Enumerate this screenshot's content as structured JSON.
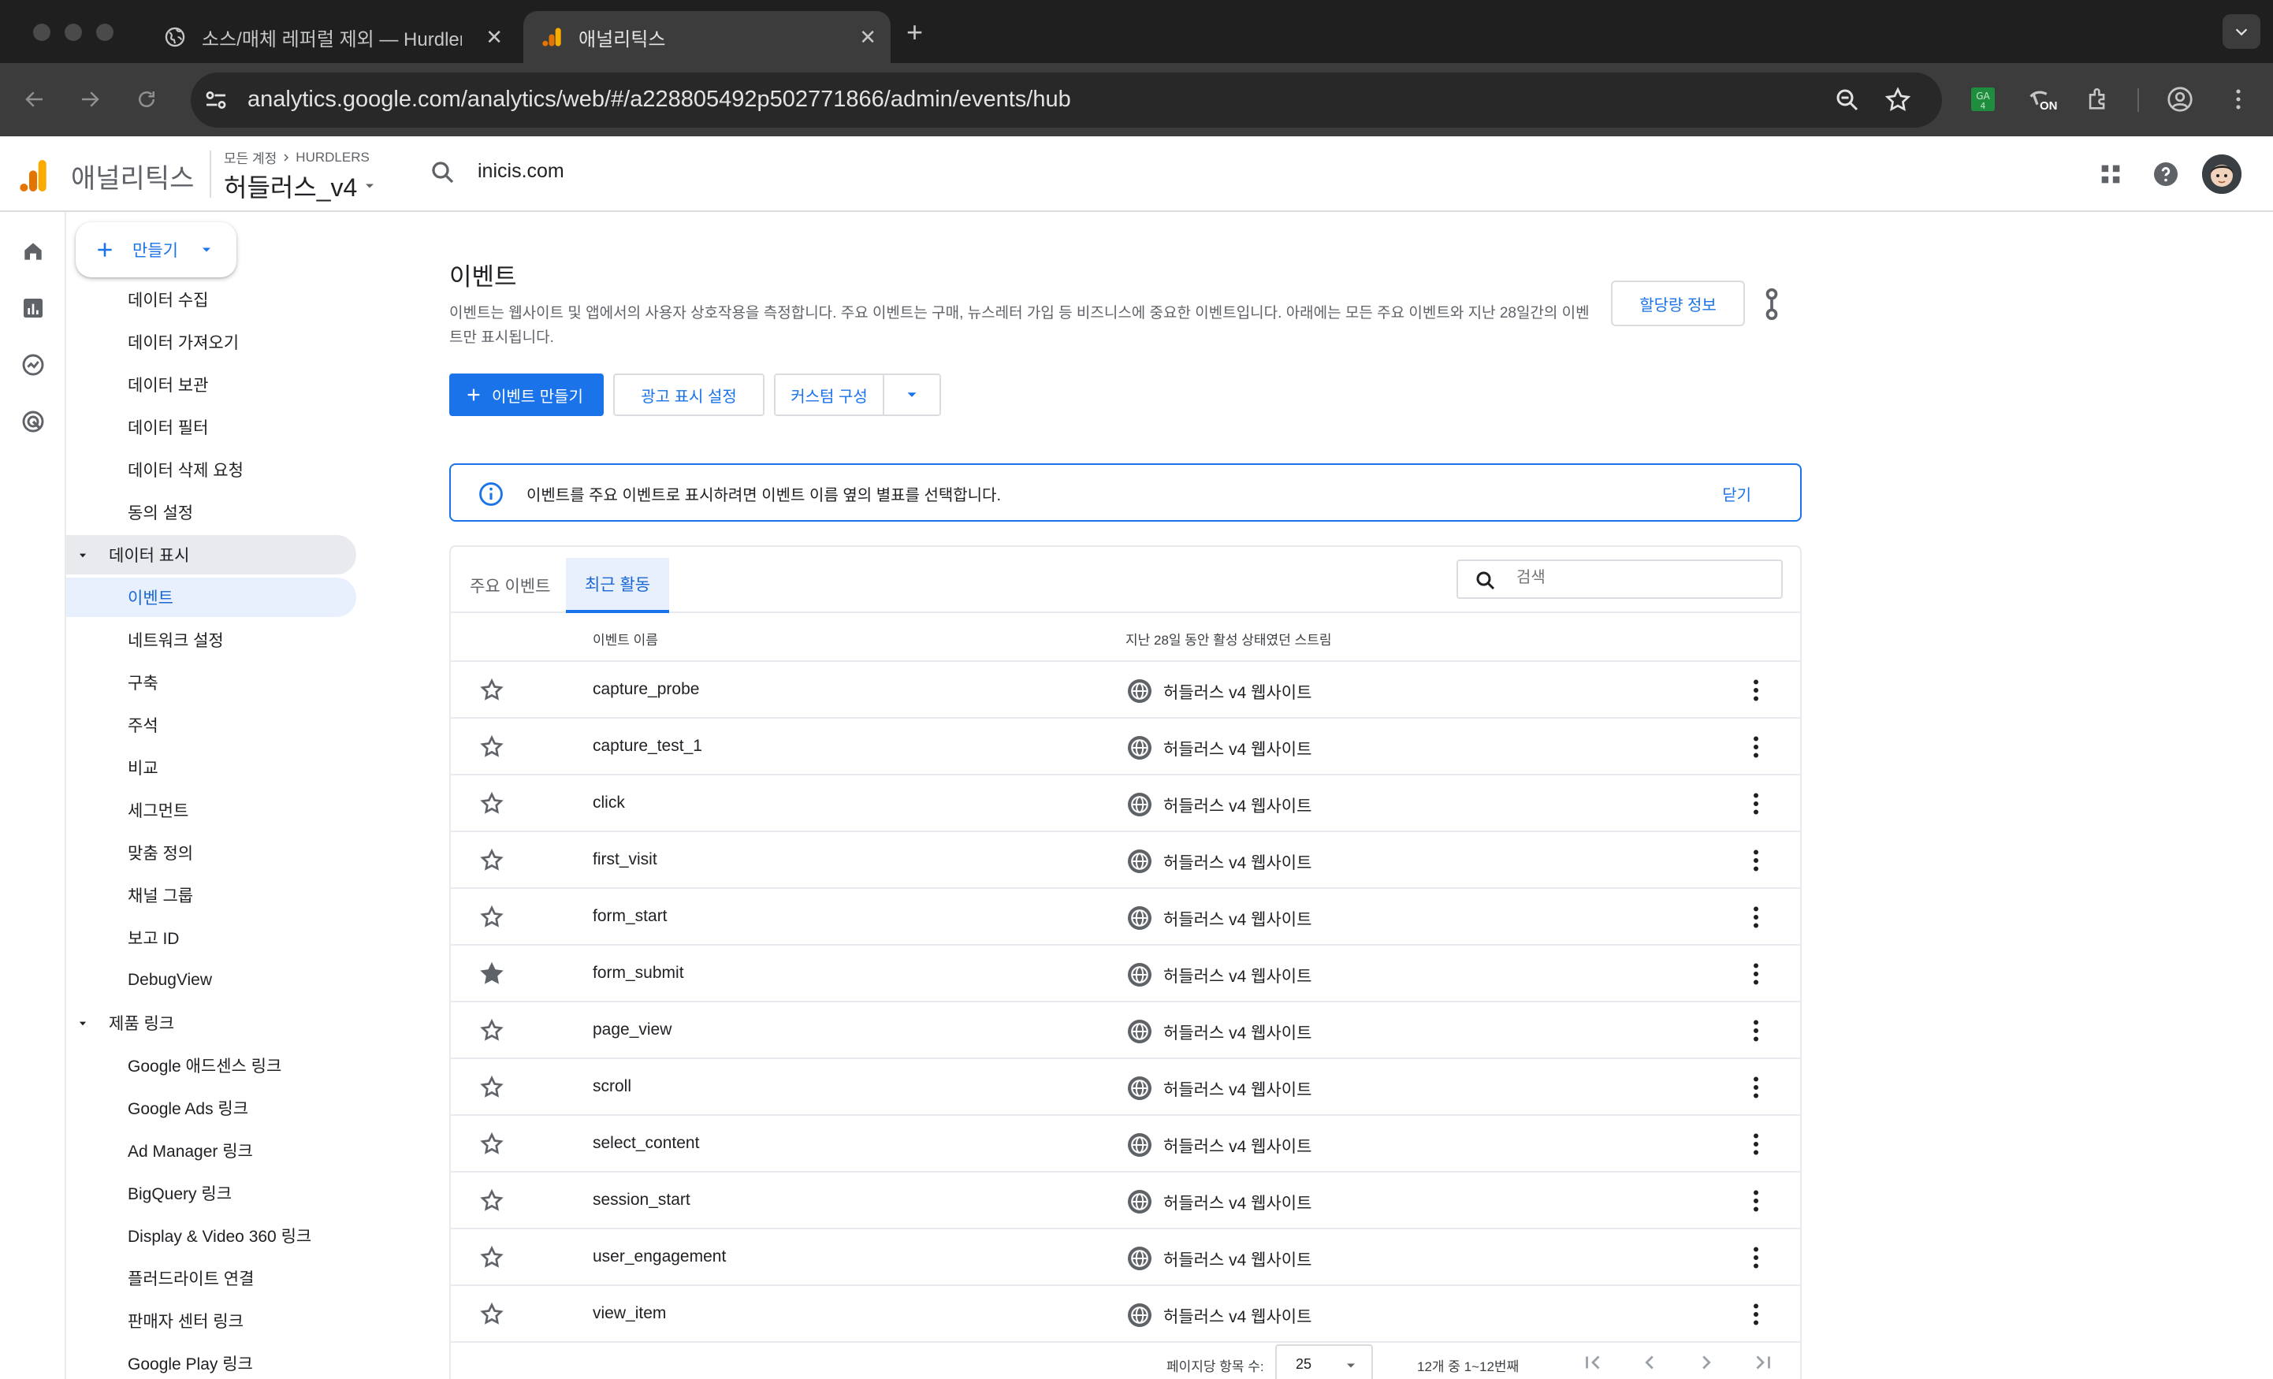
{
  "browser": {
    "tabs": [
      {
        "title": "소스/매체 레퍼럴 제외 — Hurdlers",
        "active": false
      },
      {
        "title": "애널리틱스",
        "active": true
      }
    ],
    "url": "analytics.google.com/analytics/web/#/a228805492p502771866/admin/events/hub",
    "extension_badge": "ON"
  },
  "header": {
    "product": "애널리틱스",
    "breadcrumb_all": "모든 계정",
    "breadcrumb_account": "HURDLERS",
    "property": "허들러스_v4",
    "search_query": "inicis.com"
  },
  "sidebar": {
    "create_label": "만들기",
    "items": [
      {
        "label": "데이터 수집",
        "type": "item"
      },
      {
        "label": "데이터 가져오기",
        "type": "item"
      },
      {
        "label": "데이터 보관",
        "type": "item"
      },
      {
        "label": "데이터 필터",
        "type": "item"
      },
      {
        "label": "데이터 삭제 요청",
        "type": "item"
      },
      {
        "label": "동의 설정",
        "type": "item"
      },
      {
        "label": "데이터 표시",
        "type": "group"
      },
      {
        "label": "이벤트",
        "type": "active"
      },
      {
        "label": "네트워크 설정",
        "type": "item"
      },
      {
        "label": "구축",
        "type": "item"
      },
      {
        "label": "주석",
        "type": "item"
      },
      {
        "label": "비교",
        "type": "item"
      },
      {
        "label": "세그먼트",
        "type": "item"
      },
      {
        "label": "맞춤 정의",
        "type": "item"
      },
      {
        "label": "채널 그룹",
        "type": "item"
      },
      {
        "label": "보고 ID",
        "type": "item"
      },
      {
        "label": "DebugView",
        "type": "item"
      },
      {
        "label": "제품 링크",
        "type": "group2"
      },
      {
        "label": "Google 애드센스 링크",
        "type": "item"
      },
      {
        "label": "Google Ads 링크",
        "type": "item"
      },
      {
        "label": "Ad Manager 링크",
        "type": "item"
      },
      {
        "label": "BigQuery 링크",
        "type": "item"
      },
      {
        "label": "Display & Video 360 링크",
        "type": "item"
      },
      {
        "label": "플러드라이트 연결",
        "type": "item"
      },
      {
        "label": "판매자 센터 링크",
        "type": "item"
      },
      {
        "label": "Google Play 링크",
        "type": "item"
      }
    ]
  },
  "main": {
    "title": "이벤트",
    "description": "이벤트는 웹사이트 및 앱에서의 사용자 상호작용을 측정합니다. 주요 이벤트는 구매, 뉴스레터 가입 등 비즈니스에 중요한 이벤트입니다. 아래에는 모든 주요 이벤트와 지난 28일간의 이벤트만 표시됩니다.",
    "quota_button": "할당량 정보",
    "create_event_button": "이벤트 만들기",
    "ad_settings_button": "광고 표시 설정",
    "custom_config_button": "커스텀 구성",
    "banner_text": "이벤트를 주요 이벤트로 표시하려면 이벤트 이름 옆의 별표를 선택합니다.",
    "banner_close": "닫기",
    "tabs": [
      "주요 이벤트",
      "최근 활동"
    ],
    "search_placeholder": "검색",
    "col_event_name": "이벤트 이름",
    "col_stream": "지난 28일 동안 활성 상태였던 스트림",
    "rows": [
      {
        "name": "capture_probe",
        "stream": "허들러스 v4 웹사이트",
        "key": false
      },
      {
        "name": "capture_test_1",
        "stream": "허들러스 v4 웹사이트",
        "key": false
      },
      {
        "name": "click",
        "stream": "허들러스 v4 웹사이트",
        "key": false
      },
      {
        "name": "first_visit",
        "stream": "허들러스 v4 웹사이트",
        "key": false
      },
      {
        "name": "form_start",
        "stream": "허들러스 v4 웹사이트",
        "key": false
      },
      {
        "name": "form_submit",
        "stream": "허들러스 v4 웹사이트",
        "key": true
      },
      {
        "name": "page_view",
        "stream": "허들러스 v4 웹사이트",
        "key": false
      },
      {
        "name": "scroll",
        "stream": "허들러스 v4 웹사이트",
        "key": false
      },
      {
        "name": "select_content",
        "stream": "허들러스 v4 웹사이트",
        "key": false
      },
      {
        "name": "session_start",
        "stream": "허들러스 v4 웹사이트",
        "key": false
      },
      {
        "name": "user_engagement",
        "stream": "허들러스 v4 웹사이트",
        "key": false
      },
      {
        "name": "view_item",
        "stream": "허들러스 v4 웹사이트",
        "key": false
      }
    ],
    "pager": {
      "rows_per_page_label": "페이지당 항목 수:",
      "rows_per_page": "25",
      "range": "12개 중 1~12번째"
    }
  },
  "colors": {
    "accent": "#1a73e8",
    "chrome_dark": "#1f1f1f",
    "ga_orange": "#f9ab00",
    "ga_dark_orange": "#e37400"
  }
}
